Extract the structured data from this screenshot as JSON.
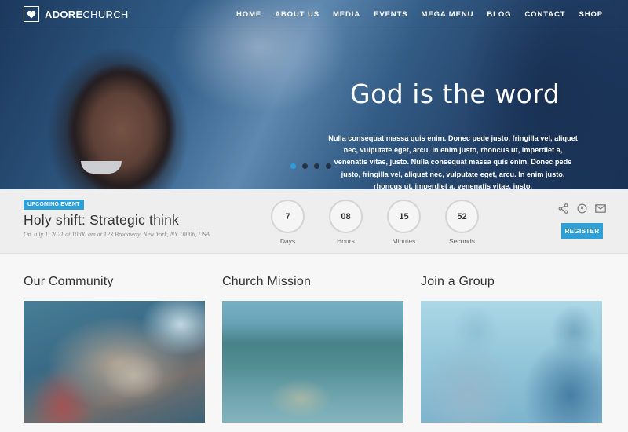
{
  "brand": {
    "bold": "ADORE",
    "light": "CHURCH"
  },
  "nav": [
    "HOME",
    "ABOUT US",
    "MEDIA",
    "EVENTS",
    "MEGA MENU",
    "BLOG",
    "CONTACT",
    "SHOP"
  ],
  "hero": {
    "title": "God is the word",
    "text": "Nulla consequat massa quis enim. Donec pede justo, fringilla vel, aliquet nec, vulputate eget, arcu. In enim justo, rhoncus ut, imperdiet a, venenatis vitae, justo. Nulla consequat massa quis enim. Donec pede justo, fringilla vel, aliquet nec, vulputate eget, arcu. In enim justo, rhoncus ut, imperdiet a, venenatis vitae, justo."
  },
  "event": {
    "badge": "UPCOMING EVENT",
    "title": "Holy shift: Strategic think",
    "meta": "On July 1, 2021 at 10:00 am at 123 Broadway, New York, NY 10006, USA",
    "countdown": [
      {
        "value": "7",
        "label": "Days"
      },
      {
        "value": "08",
        "label": "Hours"
      },
      {
        "value": "15",
        "label": "Minutes"
      },
      {
        "value": "52",
        "label": "Seconds"
      }
    ],
    "register_label": "REGISTER"
  },
  "cards": [
    {
      "title": "Our Community"
    },
    {
      "title": "Church Mission"
    },
    {
      "title": "Join a Group"
    }
  ],
  "colors": {
    "accent": "#2f9fd8",
    "text": "#333333"
  },
  "icons": [
    "heart-icon",
    "share-icon",
    "podcast-icon",
    "mail-icon"
  ]
}
